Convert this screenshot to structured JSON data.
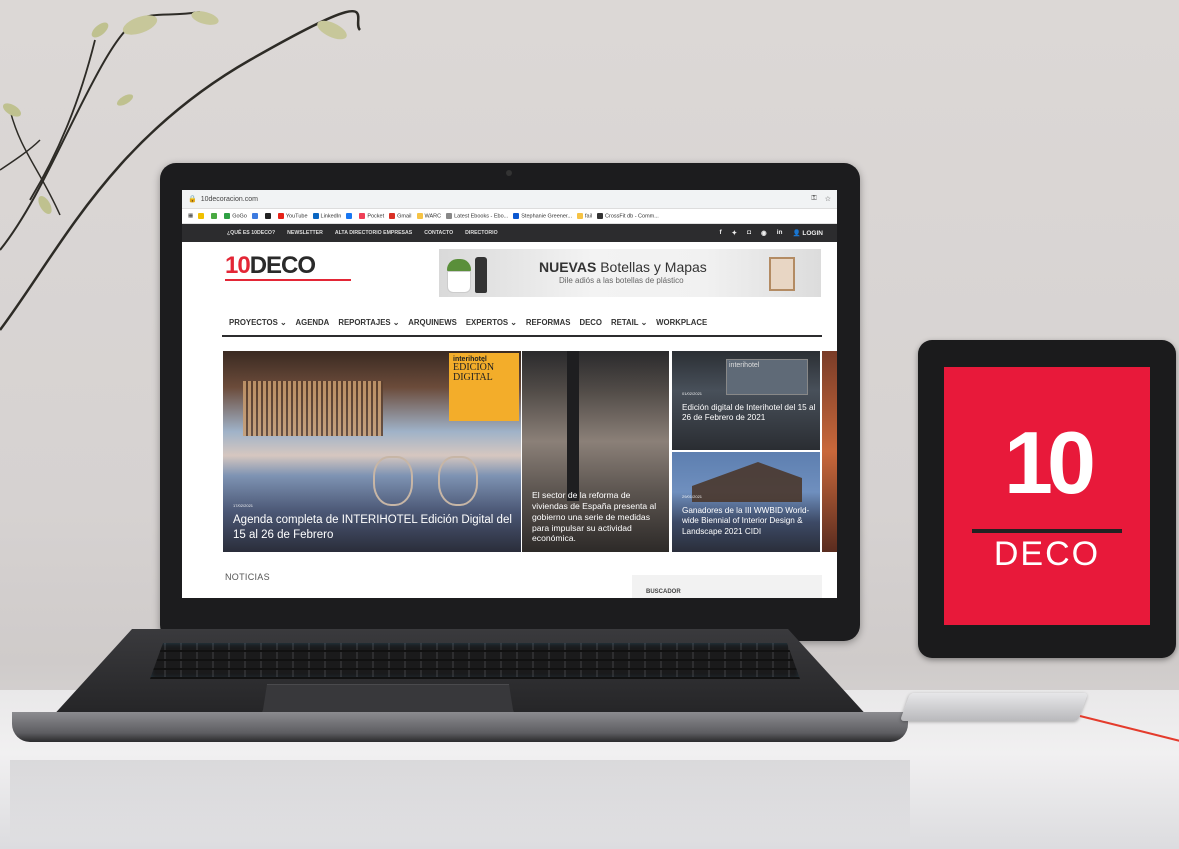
{
  "browser": {
    "url": "10decoracion.com",
    "bookmarks": [
      "GoGo",
      "YouTube",
      "LinkedIn",
      "Pocket",
      "Gmail",
      "WARC",
      "Latest Ebooks - Ebo...",
      "Stephanie Greener...",
      "fail",
      "CrossFit db - Comm..."
    ]
  },
  "site": {
    "topnav": [
      "¿QUÉ ES 10DECO?",
      "NEWSLETTER",
      "ALTA DIRECTORIO EMPRESAS",
      "CONTACTO",
      "DIRECTORIO"
    ],
    "social_icons": [
      "f",
      "✦",
      "◘",
      "◉",
      "in"
    ],
    "login": "LOGIN",
    "logo": "10DECO",
    "logo_ten": "10",
    "logo_deco": "DECO",
    "banner_title_bold": "NUEVAS",
    "banner_title_rest": " Botellas y Mapas",
    "banner_sub": "Dile adiós a las botellas de plástico",
    "mainnav": [
      "PROYECTOS ⌄",
      "AGENDA",
      "REPORTAJES ⌄",
      "ARQUINEWS",
      "EXPERTOS ⌄",
      "REFORMAS",
      "DECO",
      "RETAIL ⌄",
      "WORKPLACE"
    ],
    "inset_line1": "interihotel",
    "inset_line2": "EDICIÓN",
    "inset_line3": "DIGITAL",
    "tiles": {
      "main_date": "17/02/2021",
      "main_title": "Agenda completa de INTERIHOTEL Edición Digital del 15 al 26 de Febrero",
      "mid_title": "El sector de la reforma de viviendas de España presenta al gobierno una serie de medidas para impulsar su actividad económica.",
      "r1_screen": "interihotel",
      "r1_date": "01/02/2021",
      "r1_title": "Edición digital de Interihotel del 15 al 26 de Febrero de 2021",
      "r2_date": "29/01/2021",
      "r2_title": "Ganadores de la III WWBID World-wide Biennial of Interior Design & Landscape 2021 CIDI"
    },
    "noticias": "NOTICIAS",
    "buscador": "BUSCADOR"
  },
  "tablet": {
    "ten": "10",
    "deco": "DECO"
  },
  "colors": {
    "brand_red": "#e8193a",
    "nav_dark": "#2c2c2e"
  }
}
